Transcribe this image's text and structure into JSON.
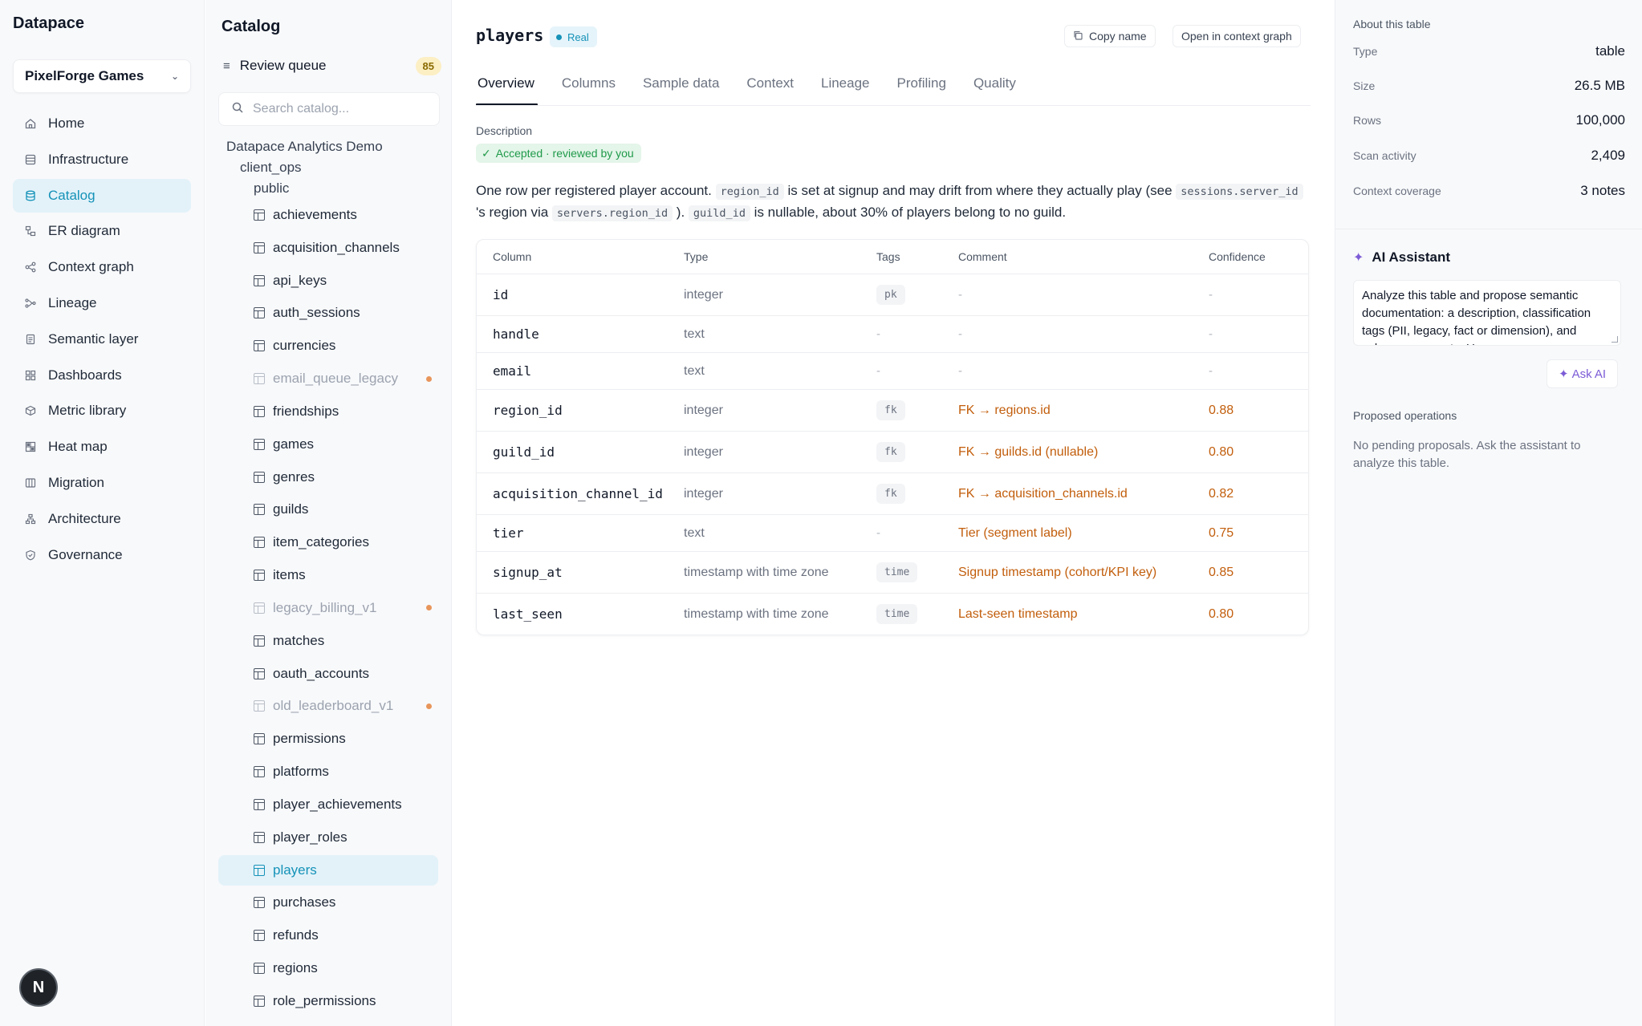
{
  "app": {
    "name": "Datapace"
  },
  "workspace": {
    "name": "PixelForge Games"
  },
  "nav": {
    "items": [
      {
        "label": "Home",
        "icon": "home-icon"
      },
      {
        "label": "Infrastructure",
        "icon": "server-icon"
      },
      {
        "label": "Catalog",
        "icon": "database-icon",
        "active": true
      },
      {
        "label": "ER diagram",
        "icon": "er-diagram-icon"
      },
      {
        "label": "Context graph",
        "icon": "share-icon"
      },
      {
        "label": "Lineage",
        "icon": "lineage-icon"
      },
      {
        "label": "Semantic layer",
        "icon": "document-icon"
      },
      {
        "label": "Dashboards",
        "icon": "dashboard-icon"
      },
      {
        "label": "Metric library",
        "icon": "cube-icon"
      },
      {
        "label": "Heat map",
        "icon": "grid-icon"
      },
      {
        "label": "Migration",
        "icon": "columns-icon"
      },
      {
        "label": "Architecture",
        "icon": "architecture-icon"
      },
      {
        "label": "Governance",
        "icon": "shield-icon"
      }
    ],
    "avatar_letter": "N"
  },
  "catalog": {
    "title": "Catalog",
    "review_queue": {
      "label": "Review queue",
      "count": "85"
    },
    "search_placeholder": "Search catalog...",
    "tree": {
      "database": "Datapace Analytics Demo",
      "schema": "client_ops",
      "namespace": "public"
    },
    "tables": [
      {
        "name": "achievements"
      },
      {
        "name": "acquisition_channels"
      },
      {
        "name": "api_keys"
      },
      {
        "name": "auth_sessions"
      },
      {
        "name": "currencies"
      },
      {
        "name": "email_queue_legacy",
        "legacy": true
      },
      {
        "name": "friendships"
      },
      {
        "name": "games"
      },
      {
        "name": "genres"
      },
      {
        "name": "guilds"
      },
      {
        "name": "item_categories"
      },
      {
        "name": "items"
      },
      {
        "name": "legacy_billing_v1",
        "legacy": true
      },
      {
        "name": "matches"
      },
      {
        "name": "oauth_accounts"
      },
      {
        "name": "old_leaderboard_v1",
        "legacy": true
      },
      {
        "name": "permissions"
      },
      {
        "name": "platforms"
      },
      {
        "name": "player_achievements"
      },
      {
        "name": "player_roles"
      },
      {
        "name": "players",
        "selected": true
      },
      {
        "name": "purchases"
      },
      {
        "name": "refunds"
      },
      {
        "name": "regions"
      },
      {
        "name": "role_permissions"
      }
    ]
  },
  "main": {
    "title": "players",
    "badge": "Real",
    "copy_button": "Copy name",
    "context_button": "Open in context graph",
    "tabs": [
      "Overview",
      "Columns",
      "Sample data",
      "Context",
      "Lineage",
      "Profiling",
      "Quality"
    ],
    "active_tab": "Overview",
    "description_label": "Description",
    "description_status": "Accepted · reviewed by you",
    "description": {
      "p1": "One row per registered player account. ",
      "code1": "region_id",
      "p2": " is set at signup and may drift from where they actually play (see ",
      "code2": "sessions.server_id",
      "p3": " 's region via ",
      "code3": "servers.region_id",
      "p4": " ). ",
      "code4": "guild_id",
      "p5": " is nullable, about 30% of players belong to no guild."
    },
    "columns_table": {
      "headers": [
        "Column",
        "Type",
        "Tags",
        "Comment",
        "Confidence"
      ],
      "rows": [
        {
          "column": "id",
          "type": "integer",
          "tag": "pk",
          "comment": "-",
          "confidence": "-",
          "suggested": false
        },
        {
          "column": "handle",
          "type": "text",
          "tag": "-",
          "comment": "-",
          "confidence": "-",
          "suggested": false
        },
        {
          "column": "email",
          "type": "text",
          "tag": "-",
          "comment": "-",
          "confidence": "-",
          "suggested": false
        },
        {
          "column": "region_id",
          "type": "integer",
          "tag": "fk",
          "comment": "FK → regions.id",
          "confidence": "0.88",
          "suggested": true
        },
        {
          "column": "guild_id",
          "type": "integer",
          "tag": "fk",
          "comment": "FK → guilds.id (nullable)",
          "confidence": "0.80",
          "suggested": true
        },
        {
          "column": "acquisition_channel_id",
          "type": "integer",
          "tag": "fk",
          "comment": "FK → acquisition_channels.id",
          "confidence": "0.82",
          "suggested": true
        },
        {
          "column": "tier",
          "type": "text",
          "tag": "-",
          "comment": "Tier (segment label)",
          "confidence": "0.75",
          "suggested": true
        },
        {
          "column": "signup_at",
          "type": "timestamp with time zone",
          "tag": "time",
          "comment": "Signup timestamp (cohort/KPI key)",
          "confidence": "0.85",
          "suggested": true
        },
        {
          "column": "last_seen",
          "type": "timestamp with time zone",
          "tag": "time",
          "comment": "Last-seen timestamp",
          "confidence": "0.80",
          "suggested": true
        }
      ]
    }
  },
  "about": {
    "label": "About this table",
    "items": [
      {
        "key": "Type",
        "value": "table"
      },
      {
        "key": "Size",
        "value": "26.5 MB"
      },
      {
        "key": "Rows",
        "value": "100,000"
      },
      {
        "key": "Scan activity",
        "value": "2,409"
      },
      {
        "key": "Context coverage",
        "value": "3 notes"
      }
    ]
  },
  "assistant": {
    "title": "AI Assistant",
    "prompt": "Analyze this table and propose semantic documentation: a description, classification tags (PII, legacy, fact or dimension), and column comments. Use",
    "ask_button": "Ask AI",
    "proposed_label": "Proposed operations",
    "empty_text": "No pending proposals. Ask the assistant to analyze this table."
  },
  "colors": {
    "accent": "#1592b8",
    "suggestion": "#c25e0c",
    "ai": "#7c5cd6",
    "legacy_dot": "#e8955b"
  }
}
